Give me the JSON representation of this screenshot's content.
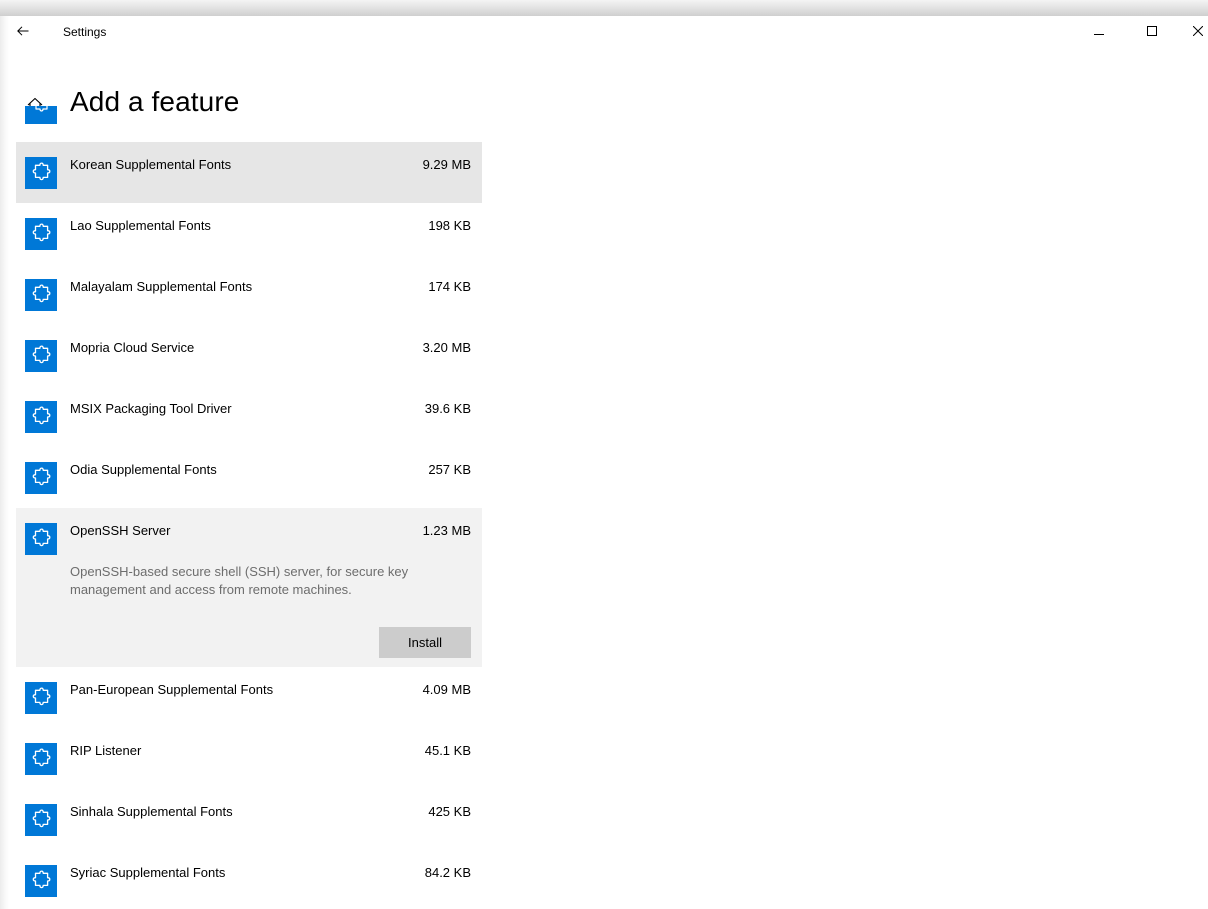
{
  "window": {
    "app_title": "Settings",
    "back_icon": "back-arrow-icon",
    "controls": [
      "minimize-icon",
      "maximize-icon",
      "close-icon"
    ]
  },
  "header": {
    "home_icon": "home-icon",
    "title": "Add a feature"
  },
  "colors": {
    "accent": "#0078d7",
    "hover_row": "#e6e6e6",
    "expanded_row": "#f2f2f2",
    "install_button": "#cccccc",
    "description_text": "#6d6d6d"
  },
  "features": [
    {
      "name": "Korean Supplemental Fonts",
      "size": "9.29 MB",
      "icon": "puzzle-piece-icon",
      "state": "hover"
    },
    {
      "name": "Lao Supplemental Fonts",
      "size": "198 KB",
      "icon": "puzzle-piece-icon"
    },
    {
      "name": "Malayalam Supplemental Fonts",
      "size": "174 KB",
      "icon": "puzzle-piece-icon"
    },
    {
      "name": "Mopria Cloud Service",
      "size": "3.20 MB",
      "icon": "puzzle-piece-icon"
    },
    {
      "name": "MSIX Packaging Tool Driver",
      "size": "39.6 KB",
      "icon": "puzzle-piece-icon"
    },
    {
      "name": "Odia Supplemental Fonts",
      "size": "257 KB",
      "icon": "puzzle-piece-icon"
    },
    {
      "name": "OpenSSH Server",
      "size": "1.23 MB",
      "icon": "puzzle-piece-icon",
      "state": "expanded",
      "description": "OpenSSH-based secure shell (SSH) server, for secure key management and access from remote machines.",
      "action_label": "Install"
    },
    {
      "name": "Pan-European Supplemental Fonts",
      "size": "4.09 MB",
      "icon": "puzzle-piece-icon"
    },
    {
      "name": "RIP Listener",
      "size": "45.1 KB",
      "icon": "puzzle-piece-icon"
    },
    {
      "name": "Sinhala Supplemental Fonts",
      "size": "425 KB",
      "icon": "puzzle-piece-icon"
    },
    {
      "name": "Syriac Supplemental Fonts",
      "size": "84.2 KB",
      "icon": "puzzle-piece-icon"
    }
  ]
}
